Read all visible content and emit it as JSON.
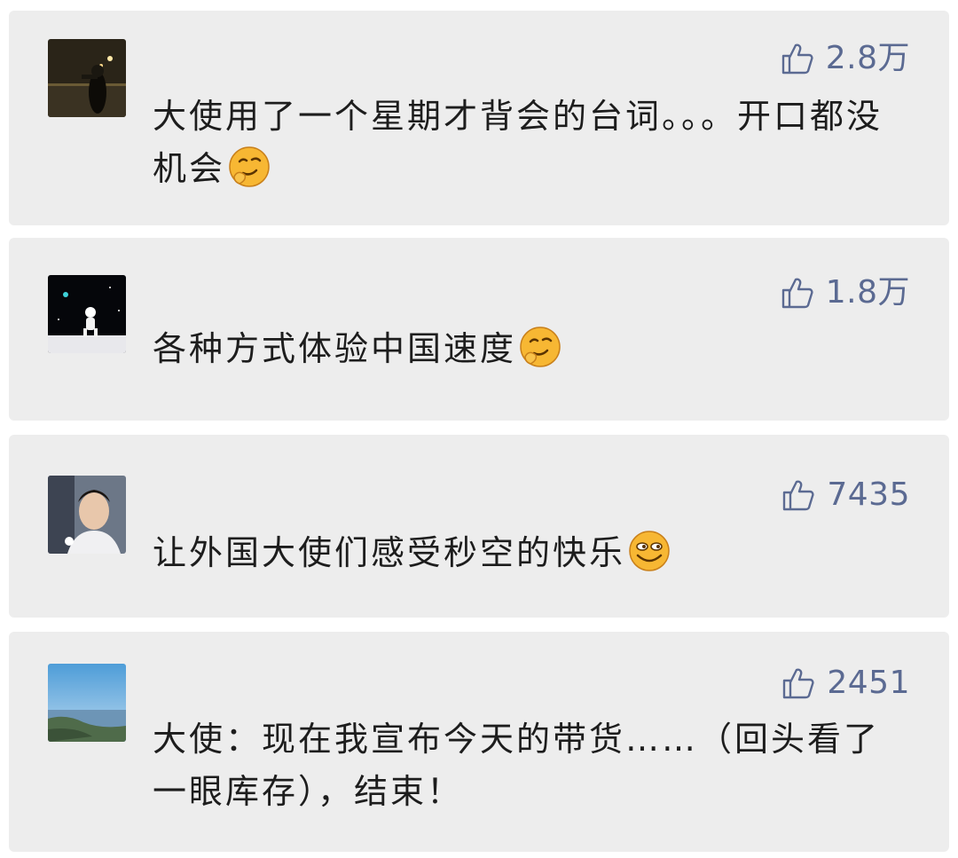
{
  "comments": [
    {
      "avatar": "night-street-photo",
      "username": "",
      "likes": "2.8万",
      "text": "大使用了一个星期才背会的台词。。。开口都没机会",
      "emoji": "smirk-emoji"
    },
    {
      "avatar": "astronaut-space-photo",
      "username": "",
      "likes": "1.8万",
      "text": "各种方式体验中国速度",
      "emoji": "smirk-emoji"
    },
    {
      "avatar": "portrait-photo",
      "username": "",
      "likes": "7435",
      "text": "让外国大使们感受秒空的快乐",
      "emoji": "grin-emoji"
    },
    {
      "avatar": "coastline-landscape-photo",
      "username": "",
      "likes": "2451",
      "text": "大使：现在我宣布今天的带货……（回头看了一眼库存），结束！",
      "emoji": ""
    }
  ],
  "colors": {
    "card_background": "#ededed",
    "like_count": "#5b6a92",
    "comment_text": "#1d1d1d",
    "emoji_fill": "#f7b733"
  }
}
